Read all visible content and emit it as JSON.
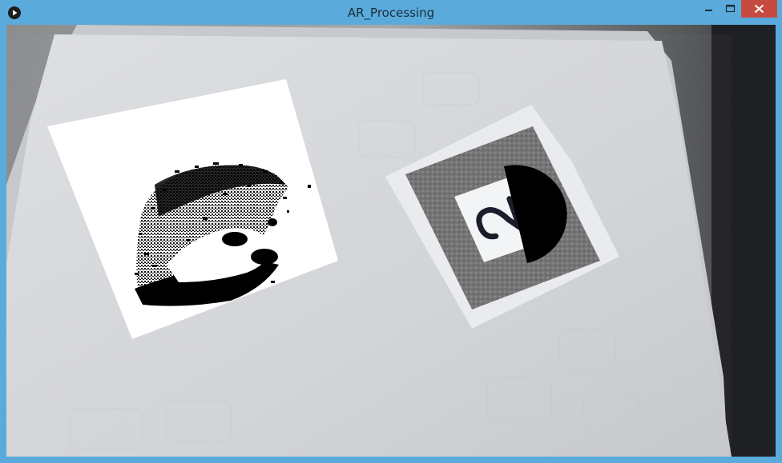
{
  "window": {
    "title": "AR_Processing",
    "app_icon": "processing-play-icon",
    "controls": {
      "minimize_icon": "minimize-icon",
      "maximize_icon": "maximize-icon",
      "close_icon": "close-icon"
    }
  },
  "scene": {
    "camera_feed": "webcam-frame",
    "marker_symbol": "2",
    "overlay_left": "dithered-hedgehog-image",
    "overlay_right": "black-half-disc"
  },
  "colors": {
    "titlebar": "#5aabdc",
    "close_button": "#c74a40",
    "title_text": "#1b2c38"
  }
}
